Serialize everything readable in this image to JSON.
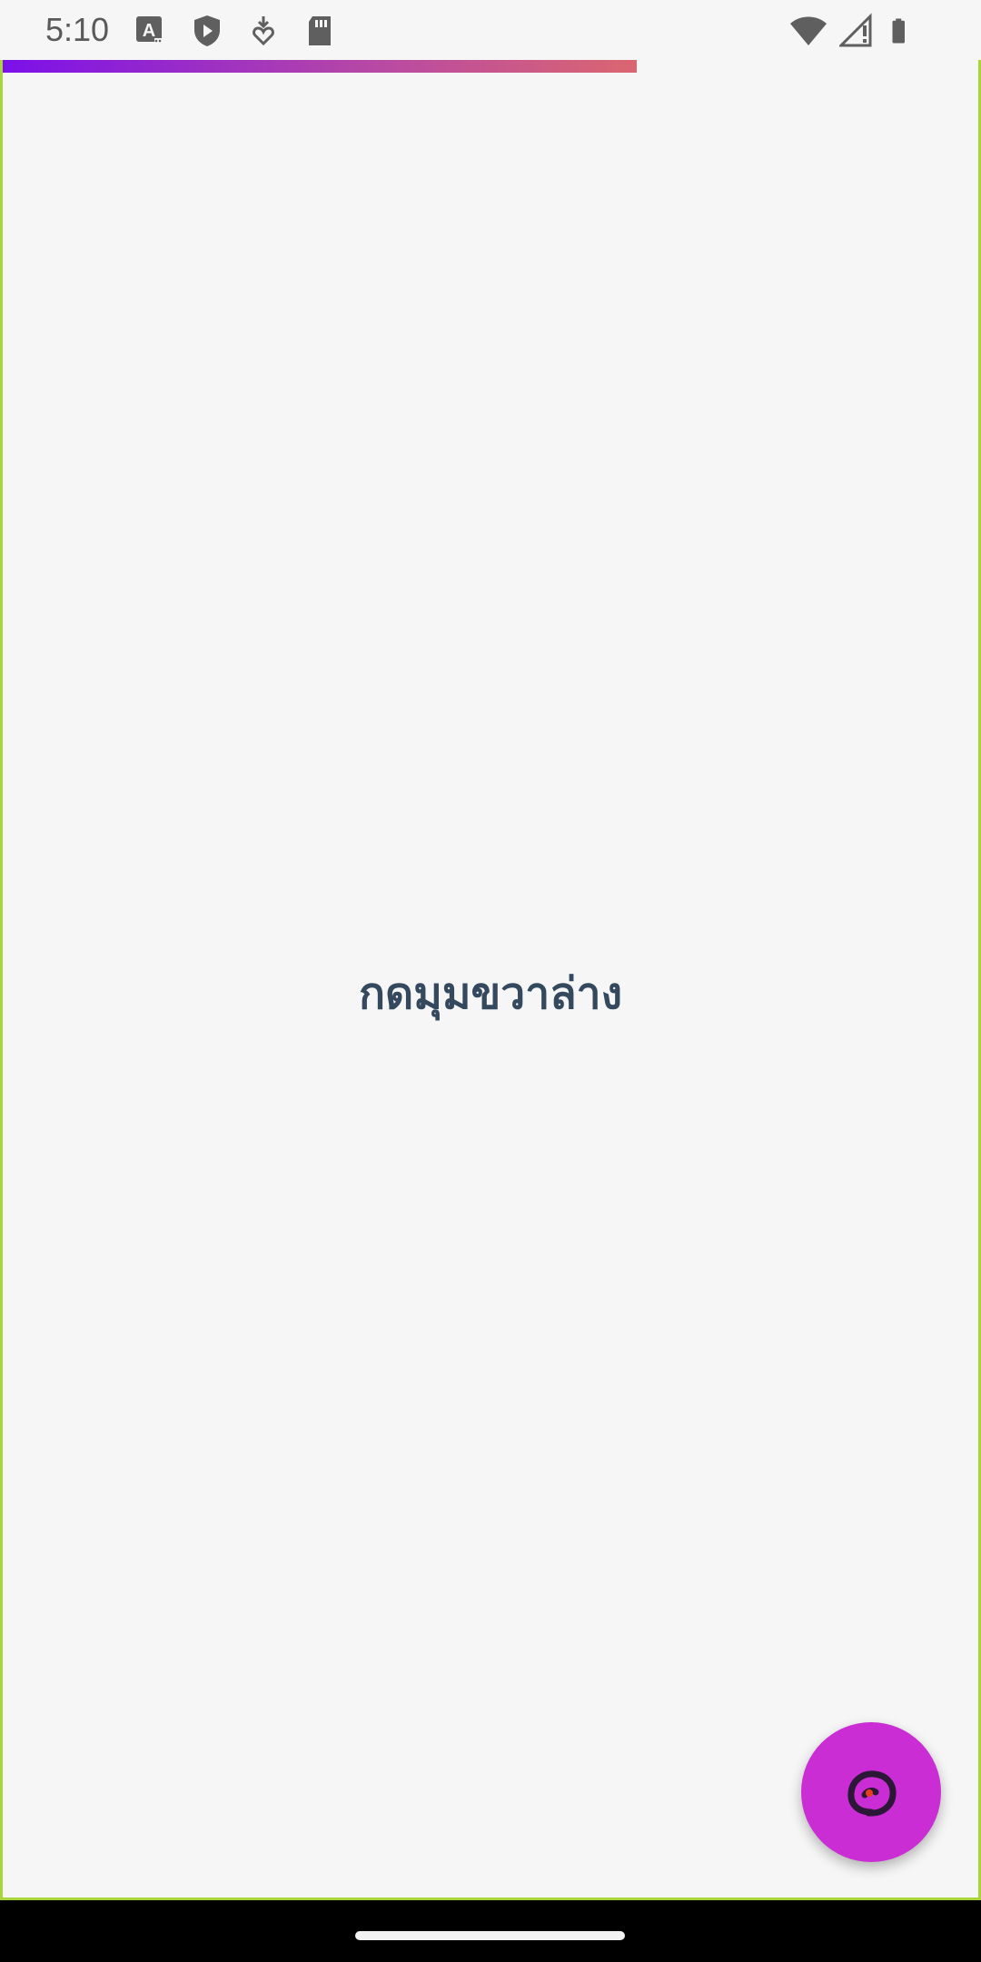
{
  "status_bar": {
    "time": "5:10",
    "left_icons": [
      "font-icon",
      "shield-play-icon",
      "download-heart-icon",
      "sd-card-icon"
    ],
    "right_icons": [
      "wifi-icon",
      "signal-no-data-icon",
      "battery-icon"
    ]
  },
  "page": {
    "load_progress_percent": 65,
    "center_text": "กดมุมขวาล่าง",
    "progress_gradient": [
      "#7b10ea",
      "#db6670"
    ],
    "accent_border": "#a8d63a"
  },
  "fab": {
    "color": "#c92dd3",
    "icon": "swirl-icon"
  }
}
